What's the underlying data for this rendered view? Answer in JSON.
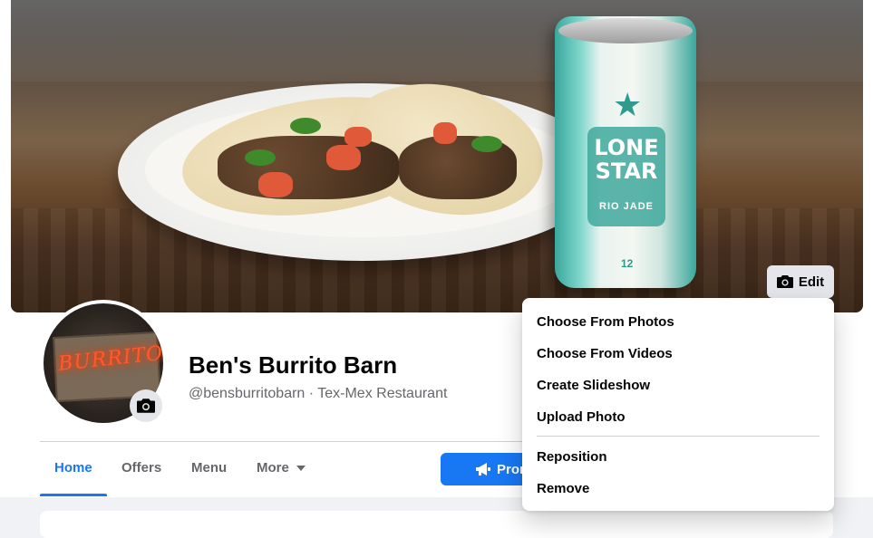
{
  "cover": {
    "edit_label": "Edit",
    "can_brand": "LONE STAR",
    "can_variant": "RIO JADE",
    "can_size": "12"
  },
  "profile": {
    "avatar_sign": "BURRITOS",
    "name": "Ben's Burrito Barn",
    "subtitle": "@bensburritobarn · Tex-Mex Restaurant"
  },
  "tabs": [
    {
      "label": "Home",
      "active": true
    },
    {
      "label": "Offers"
    },
    {
      "label": "Menu"
    },
    {
      "label": "More"
    }
  ],
  "promote_label": "Promote",
  "cover_menu": {
    "items": [
      "Choose From Photos",
      "Choose From Videos",
      "Create Slideshow",
      "Upload Photo"
    ],
    "secondary_items": [
      "Reposition",
      "Remove"
    ]
  },
  "colors": {
    "accent": "#1877f2",
    "secondary_text": "#65676b",
    "button_gray": "#e4e6eb"
  }
}
